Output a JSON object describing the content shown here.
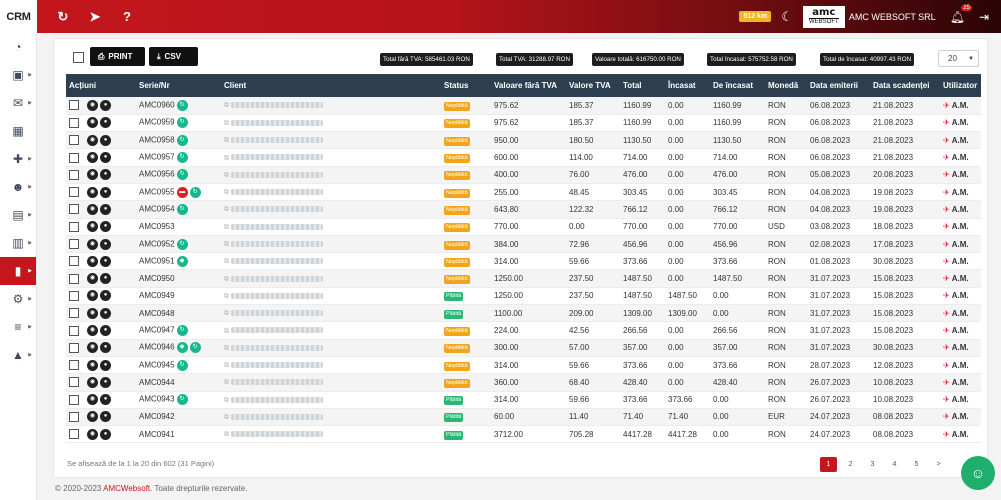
{
  "app": {
    "brand": "CRM"
  },
  "topbar": {
    "icons": [
      "refresh-icon",
      "send-icon",
      "help-icon"
    ],
    "credit_badge": "512 km",
    "company_logo_top": "amc",
    "company_logo_bottom": "WEBSOFT",
    "company_name": "AMC WEBSOFT SRL",
    "notifications_count": "25"
  },
  "sidebar": {
    "items": [
      {
        "icon": "dashboard-icon",
        "glyph": "◔"
      },
      {
        "icon": "briefcase-icon",
        "glyph": "▣"
      },
      {
        "icon": "mail-icon",
        "glyph": "✉"
      },
      {
        "icon": "calendar-icon",
        "glyph": "▦"
      },
      {
        "icon": "add-user-icon",
        "glyph": "✚"
      },
      {
        "icon": "users-icon",
        "glyph": "☻"
      },
      {
        "icon": "id-card-icon",
        "glyph": "▤"
      },
      {
        "icon": "building-icon",
        "glyph": "▥"
      },
      {
        "icon": "chart-icon",
        "glyph": "▮"
      },
      {
        "icon": "cogs-icon",
        "glyph": "⚙"
      },
      {
        "icon": "server-icon",
        "glyph": "≡"
      },
      {
        "icon": "lock-icon",
        "glyph": "▲"
      }
    ]
  },
  "toolbar": {
    "print_label": "PRINT",
    "csv_label": "CSV",
    "totals": [
      "Total fără TVA: 585461.03 RON",
      "Total TVA: 31288.97 RON",
      "Valoare totală: 616750.00 RON",
      "Total încasat: 575752.58 RON",
      "Total de încasat: 40997.43 RON"
    ],
    "page_size": "20"
  },
  "table": {
    "headers": [
      "Acțiuni",
      "Serie/Nr",
      "Client",
      "Status",
      "Valoare fără TVA",
      "Valore TVA",
      "Total",
      "Încasat",
      "De încasat",
      "Monedă",
      "Data emiterii",
      "Data scadenței",
      "Utilizator"
    ],
    "rows": [
      {
        "nr": "AMC0960",
        "badge": "c",
        "status": "Neplătită",
        "st": "o",
        "val": "975.62",
        "tva": "185.37",
        "total": "1160.99",
        "inc": "0.00",
        "deinc": "1160.99",
        "cur": "RON",
        "em": "06.08.2023",
        "sc": "21.08.2023",
        "user": "A.M."
      },
      {
        "nr": "AMC0959",
        "badge": "c",
        "status": "Neplătită",
        "st": "o",
        "val": "975.62",
        "tva": "185.37",
        "total": "1160.99",
        "inc": "0.00",
        "deinc": "1160.99",
        "cur": "RON",
        "em": "06.08.2023",
        "sc": "21.08.2023",
        "user": "A.M."
      },
      {
        "nr": "AMC0958",
        "badge": "c",
        "status": "Neplătită",
        "st": "o",
        "val": "950.00",
        "tva": "180.50",
        "total": "1130.50",
        "inc": "0.00",
        "deinc": "1130.50",
        "cur": "RON",
        "em": "06.08.2023",
        "sc": "21.08.2023",
        "user": "A.M."
      },
      {
        "nr": "AMC0957",
        "badge": "c",
        "status": "Neplătită",
        "st": "o",
        "val": "600.00",
        "tva": "114.00",
        "total": "714.00",
        "inc": "0.00",
        "deinc": "714.00",
        "cur": "RON",
        "em": "06.08.2023",
        "sc": "21.08.2023",
        "user": "A.M."
      },
      {
        "nr": "AMC0956",
        "badge": "c",
        "status": "Neplătită",
        "st": "o",
        "val": "400.00",
        "tva": "76.00",
        "total": "476.00",
        "inc": "0.00",
        "deinc": "476.00",
        "cur": "RON",
        "em": "05.08.2023",
        "sc": "20.08.2023",
        "user": "A.M."
      },
      {
        "nr": "AMC0955",
        "badge": "rc",
        "status": "Neplătită",
        "st": "o",
        "val": "255.00",
        "tva": "48.45",
        "total": "303.45",
        "inc": "0.00",
        "deinc": "303.45",
        "cur": "RON",
        "em": "04.08.2023",
        "sc": "19.08.2023",
        "user": "A.M."
      },
      {
        "nr": "AMC0954",
        "badge": "c",
        "status": "Neplătită",
        "st": "o",
        "val": "643.80",
        "tva": "122.32",
        "total": "766.12",
        "inc": "0.00",
        "deinc": "766.12",
        "cur": "RON",
        "em": "04.08.2023",
        "sc": "19.08.2023",
        "user": "A.M."
      },
      {
        "nr": "AMC0953",
        "badge": "",
        "status": "Neplătită",
        "st": "o",
        "val": "770.00",
        "tva": "0.00",
        "total": "770.00",
        "inc": "0.00",
        "deinc": "770.00",
        "cur": "USD",
        "em": "03.08.2023",
        "sc": "18.08.2023",
        "user": "A.M."
      },
      {
        "nr": "AMC0952",
        "badge": "c",
        "status": "Neplătită",
        "st": "o",
        "val": "384.00",
        "tva": "72.96",
        "total": "456.96",
        "inc": "0.00",
        "deinc": "456.96",
        "cur": "RON",
        "em": "02.08.2023",
        "sc": "17.08.2023",
        "user": "A.M."
      },
      {
        "nr": "AMC0951",
        "badge": "s",
        "status": "Neplătită",
        "st": "o",
        "val": "314.00",
        "tva": "59.66",
        "total": "373.66",
        "inc": "0.00",
        "deinc": "373.66",
        "cur": "RON",
        "em": "01.08.2023",
        "sc": "30.08.2023",
        "user": "A.M."
      },
      {
        "nr": "AMC0950",
        "badge": "",
        "status": "Neplătită",
        "st": "o",
        "val": "1250.00",
        "tva": "237.50",
        "total": "1487.50",
        "inc": "0.00",
        "deinc": "1487.50",
        "cur": "RON",
        "em": "31.07.2023",
        "sc": "15.08.2023",
        "user": "A.M."
      },
      {
        "nr": "AMC0949",
        "badge": "",
        "status": "Plătită",
        "st": "g",
        "val": "1250.00",
        "tva": "237.50",
        "total": "1487.50",
        "inc": "1487.50",
        "deinc": "0.00",
        "cur": "RON",
        "em": "31.07.2023",
        "sc": "15.08.2023",
        "user": "A.M."
      },
      {
        "nr": "AMC0948",
        "badge": "",
        "status": "Plătită",
        "st": "g",
        "val": "1100.00",
        "tva": "209.00",
        "total": "1309.00",
        "inc": "1309.00",
        "deinc": "0.00",
        "cur": "RON",
        "em": "31.07.2023",
        "sc": "15.08.2023",
        "user": "A.M."
      },
      {
        "nr": "AMC0947",
        "badge": "c",
        "status": "Neplătită",
        "st": "o",
        "val": "224.00",
        "tva": "42.56",
        "total": "266.56",
        "inc": "0.00",
        "deinc": "266.56",
        "cur": "RON",
        "em": "31.07.2023",
        "sc": "15.08.2023",
        "user": "A.M."
      },
      {
        "nr": "AMC0946",
        "badge": "sc",
        "status": "Neplătită",
        "st": "o",
        "val": "300.00",
        "tva": "57.00",
        "total": "357.00",
        "inc": "0.00",
        "deinc": "357.00",
        "cur": "RON",
        "em": "31.07.2023",
        "sc": "30.08.2023",
        "user": "A.M."
      },
      {
        "nr": "AMC0945",
        "badge": "c",
        "status": "Neplătită",
        "st": "o",
        "val": "314.00",
        "tva": "59.66",
        "total": "373.66",
        "inc": "0.00",
        "deinc": "373.66",
        "cur": "RON",
        "em": "28.07.2023",
        "sc": "12.08.2023",
        "user": "A.M."
      },
      {
        "nr": "AMC0944",
        "badge": "",
        "status": "Neplătită",
        "st": "o",
        "val": "360.00",
        "tva": "68.40",
        "total": "428.40",
        "inc": "0.00",
        "deinc": "428.40",
        "cur": "RON",
        "em": "26.07.2023",
        "sc": "10.08.2023",
        "user": "A.M."
      },
      {
        "nr": "AMC0943",
        "badge": "c",
        "status": "Plătită",
        "st": "g",
        "val": "314.00",
        "tva": "59.66",
        "total": "373.66",
        "inc": "373.66",
        "deinc": "0.00",
        "cur": "RON",
        "em": "26.07.2023",
        "sc": "10.08.2023",
        "user": "A.M."
      },
      {
        "nr": "AMC0942",
        "badge": "",
        "status": "Plătită",
        "st": "g",
        "val": "60.00",
        "tva": "11.40",
        "total": "71.40",
        "inc": "71.40",
        "deinc": "0.00",
        "cur": "EUR",
        "em": "24.07.2023",
        "sc": "08.08.2023",
        "user": "A.M."
      },
      {
        "nr": "AMC0941",
        "badge": "",
        "status": "Plătită",
        "st": "g",
        "val": "3712.00",
        "tva": "705.28",
        "total": "4417.28",
        "inc": "4417.28",
        "deinc": "0.00",
        "cur": "RON",
        "em": "24.07.2023",
        "sc": "08.08.2023",
        "user": "A.M."
      }
    ]
  },
  "footer": {
    "info": "Se afișează de la 1 la 20 din 602 (31 Pagini)",
    "pages": [
      "1",
      "2",
      "3",
      "4",
      "5",
      ">"
    ],
    "current_page": "1",
    "copyright_prefix": "© 2020-2023",
    "copyright_brand": "AMCWebsoft",
    "copyright_suffix": ". Toate drepturile rezervate."
  },
  "colors": {
    "accent": "#c4161c",
    "header_bg": "#2d3e50",
    "unpaid": "#f2a51a",
    "paid": "#2bb673",
    "chat": "#1fae6b"
  }
}
